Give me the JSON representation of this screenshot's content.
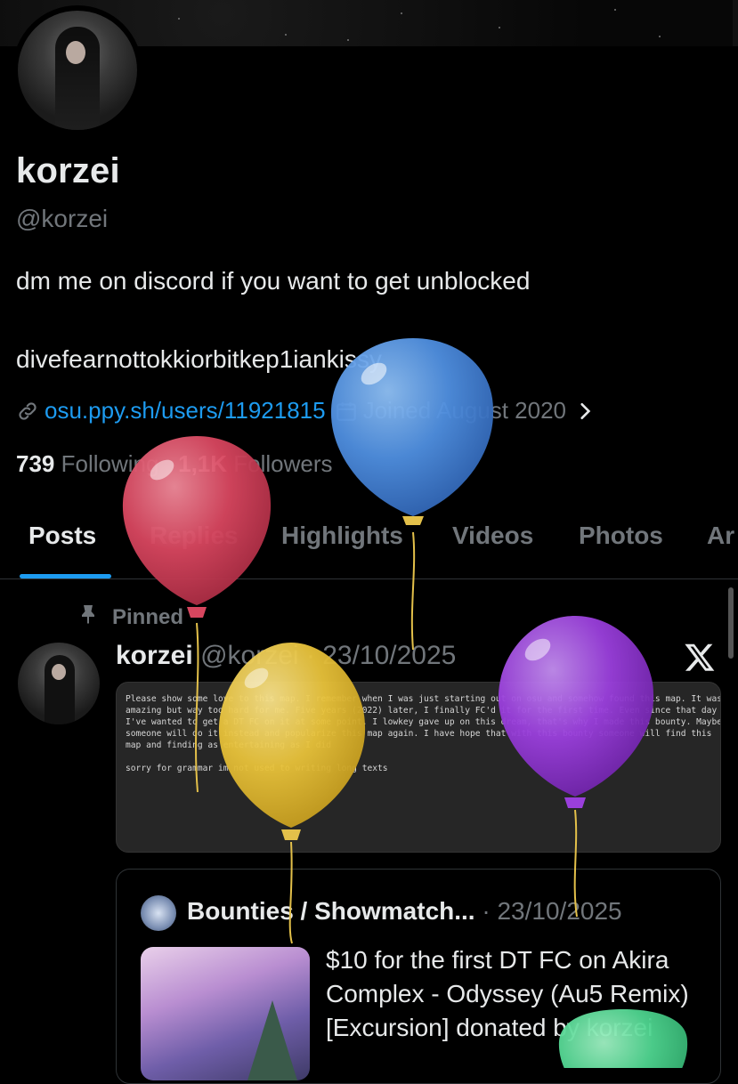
{
  "profile": {
    "name": "korzei",
    "handle": "@korzei",
    "bio_line1": "dm me on discord if you want to get unblocked",
    "bio_line2": "divefearnottokkiorbitkep1iankissy",
    "link": "osu.ppy.sh/users/11921815",
    "joined": "Joined August 2020",
    "following_count": "739",
    "following_label": "Following",
    "followers_count": "1,1K",
    "followers_label": "Followers"
  },
  "tabs": [
    "Posts",
    "Replies",
    "Highlights",
    "Videos",
    "Photos",
    "Ar"
  ],
  "post": {
    "pinned_label": "Pinned",
    "author": "korzei",
    "handle_date": "@korzei · 23/10/2025",
    "image_text": "Please show some love to this map. I remember when I was just starting out on osu and somehow found this map. It was\namazing but way too hard for me. Five years (2022) later, I finally FC'd it for the first time. Even since that day\nI've wanted to get a DT FC on it at some point. I lowkey gave up on this dream, that's why I made this bounty. Maybe\nsomeone will do it instead and popularize this map again. I have hope that with this bounty someone will find this\nmap and finding as entertaining as I did\n\nsorry for grammar im not used to writing long texts"
  },
  "quote": {
    "account": "Bounties / Showmatch...",
    "date": "· 23/10/2025",
    "text": "$10 for the first DT FC on Akira Complex - Odyssey (Au5 Remix) [Excursion] donated by korzei"
  },
  "colors": {
    "background": "#000000",
    "text": "#e7e9ea",
    "muted": "#71767b",
    "accent": "#1d9bf0"
  },
  "icons": [
    "link-icon",
    "calendar-icon",
    "chevron-right-icon",
    "pin-icon",
    "x-logo-icon"
  ]
}
